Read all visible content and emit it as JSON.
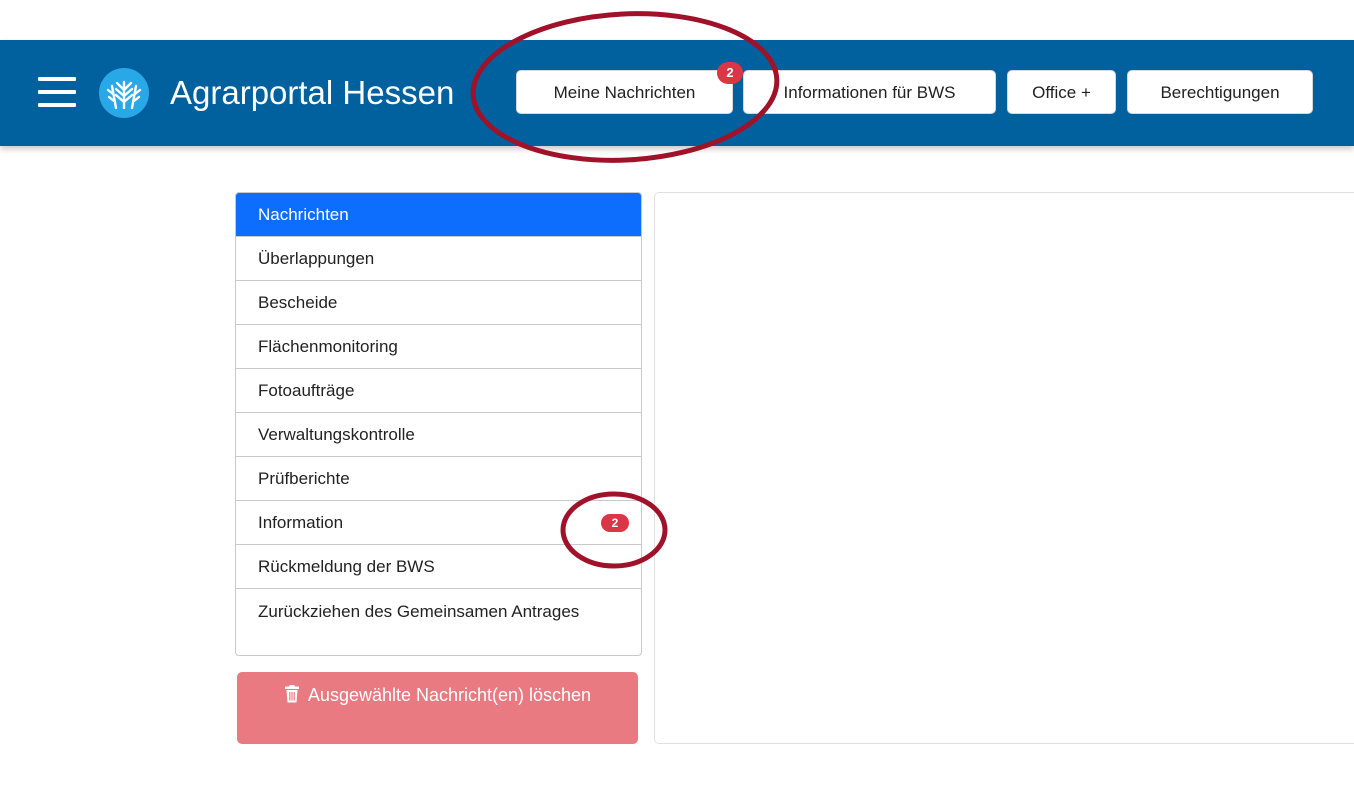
{
  "header": {
    "brand_title": "Agrarportal Hessen",
    "menu_icon": "hamburger-menu-icon",
    "logo_icon": "wheat-logo-icon",
    "background_color": "#00619e",
    "logo_color": "#29a8e8",
    "nav": [
      {
        "label": "Meine Nachrichten",
        "badge": "2"
      },
      {
        "label": "Informationen für BWS"
      },
      {
        "label": "Office +"
      },
      {
        "label": "Berechtigungen"
      }
    ]
  },
  "sidebar": {
    "active_color": "#0d6efd",
    "badge_color": "#dc3545",
    "items": [
      {
        "label": "Nachrichten"
      },
      {
        "label": "Überlappungen"
      },
      {
        "label": "Bescheide"
      },
      {
        "label": "Flächenmonitoring"
      },
      {
        "label": "Fotoaufträge"
      },
      {
        "label": "Verwaltungskontrolle"
      },
      {
        "label": "Prüfberichte"
      },
      {
        "label": "Information",
        "badge": "2"
      },
      {
        "label": "Rückmeldung der BWS"
      },
      {
        "label": "Zurückziehen des Gemeinsamen Antrages"
      }
    ]
  },
  "actions": {
    "delete_label": "Ausgewählte Nachricht(en) löschen",
    "delete_icon": "trash-icon",
    "delete_color": "#e97a82"
  },
  "annotations": {
    "highlight_color": "#a0122a"
  }
}
